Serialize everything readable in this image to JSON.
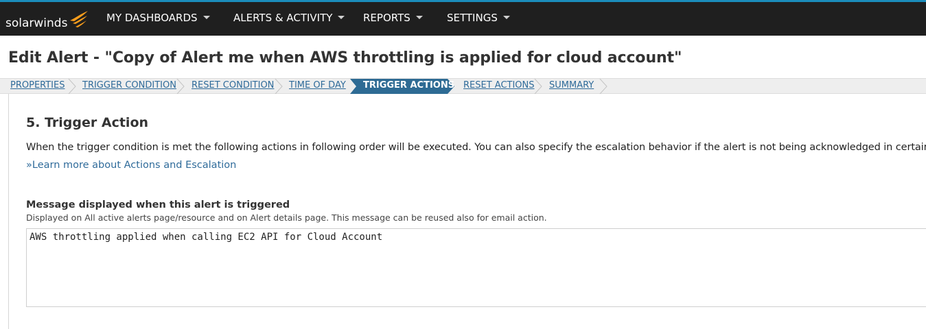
{
  "brand": {
    "name": "solarwinds",
    "accent": "#f99d1c",
    "topbar_bg": "#1f1f1f"
  },
  "nav": {
    "items": [
      {
        "label": "MY DASHBOARDS"
      },
      {
        "label": "ALERTS & ACTIVITY"
      },
      {
        "label": "REPORTS"
      },
      {
        "label": "SETTINGS"
      }
    ]
  },
  "page": {
    "title": "Edit Alert - \"Copy of Alert me when AWS throttling is applied for cloud account\""
  },
  "wizard": {
    "steps": [
      {
        "label": "PROPERTIES"
      },
      {
        "label": "TRIGGER CONDITION"
      },
      {
        "label": "RESET CONDITION"
      },
      {
        "label": "TIME OF DAY"
      },
      {
        "label": "TRIGGER ACTIONS",
        "active": true
      },
      {
        "label": "RESET ACTIONS"
      },
      {
        "label": "SUMMARY"
      }
    ],
    "active_color": "#2e6b94"
  },
  "content": {
    "section_title": "5. Trigger Action",
    "description": "When the trigger condition is met the following actions in following order will be executed. You can also specify the escalation behavior if the alert is not being acknowledged in certain time.",
    "learn_more": "»Learn more about Actions and Escalation",
    "message": {
      "label": "Message displayed when this alert is triggered",
      "help": "Displayed on All active alerts page/resource and on Alert details page. This message can be reused also for email action.",
      "value": "AWS throttling applied when calling EC2 API for Cloud Account"
    }
  }
}
